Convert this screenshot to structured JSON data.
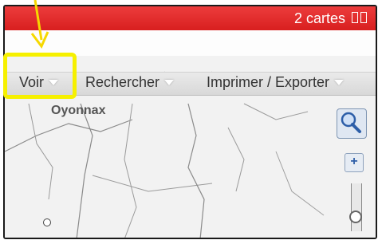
{
  "titlebar": {
    "cards_label": "2 cartes",
    "accent_color": "#e02a2a"
  },
  "menu": {
    "items": [
      {
        "label": "Voir"
      },
      {
        "label": "Rechercher"
      },
      {
        "label": "Imprimer / Exporter"
      }
    ]
  },
  "map": {
    "place_label": "Oyonnax",
    "zoom_in_label": "+"
  },
  "annotation": {
    "highlight_color": "#f6f000"
  }
}
